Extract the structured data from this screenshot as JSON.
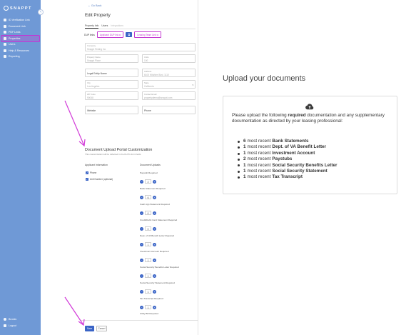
{
  "sidebar": {
    "logo": "SNAPPT",
    "items": [
      {
        "label": "ID Verification Link"
      },
      {
        "label": "Document Link"
      },
      {
        "label": "PDF Links"
      },
      {
        "label": "Properties"
      },
      {
        "label": "Users"
      },
      {
        "label": "Help & Resources"
      },
      {
        "label": "Reporting"
      }
    ],
    "bottom": [
      {
        "label": "Brooks"
      },
      {
        "label": "Logout"
      }
    ]
  },
  "form": {
    "back_label": "← Go Back",
    "title": "Edit Property",
    "tabs": [
      {
        "label": "Property Info"
      },
      {
        "label": "Users"
      },
      {
        "label": "Integrations"
      }
    ],
    "links_label": "DUP links",
    "applicant_link": "Applicant DUP link",
    "leasing_link": "Leasing Team Link",
    "company": {
      "label": "Company",
      "value": "Snappt Testing Inc"
    },
    "property_name": {
      "label": "Property Name",
      "value": "Snappt Place"
    },
    "units": {
      "label": "Units",
      "value": "100"
    },
    "legal_entity": {
      "label": "Legal Entity Name"
    },
    "address": {
      "label": "Address",
      "value": "6100 Wilshire Blvd, 1110"
    },
    "city": {
      "label": "City",
      "value": "Los Angeles"
    },
    "state": {
      "label": "State",
      "value": "California"
    },
    "zip": {
      "label": "ZIP Code",
      "value": "90048"
    },
    "contact_email": {
      "label": "Contact Email",
      "value": "propertydemo@snappt.com"
    },
    "website": {
      "label": "Website"
    },
    "phone": {
      "label": "Phone"
    },
    "portal_title": "Document Upload Portal Customization",
    "portal_subtitle": "This customization will be reflected in the DUP's form fields",
    "applicant_info_head": "Applicant Information",
    "applicant_checks": [
      {
        "label": "Phone"
      },
      {
        "label": "Unit Number (optional)"
      }
    ],
    "doc_uploads_head": "Document Uploads",
    "documents": [
      {
        "label": "Paystub Required",
        "count": "2"
      },
      {
        "label": "Bank Statement Required",
        "count": "6"
      },
      {
        "label": "Cash App Statement Required",
        "count": "0"
      },
      {
        "label": "Credit/Debit Card Statement Required",
        "count": "0"
      },
      {
        "label": "Dept. of VA Benefit Letter Required",
        "count": "1"
      },
      {
        "label": "Investment Account Required",
        "count": "1"
      },
      {
        "label": "Social Security Benefits Letter Required",
        "count": "1"
      },
      {
        "label": "Social Security Statement Required",
        "count": "1"
      },
      {
        "label": "Tax Transcript Required",
        "count": "1"
      },
      {
        "label": "Utility Bill Required",
        "count": "0"
      }
    ],
    "save_label": "Save",
    "cancel_label": "Cancel"
  },
  "preview": {
    "title": "Upload your documents",
    "intro_a": "Please upload the following ",
    "intro_b": "required",
    "intro_c": " documentation and any supplementary documentation as directed by your leasing professional:",
    "requirements": [
      {
        "count": "6",
        "text": "most recent",
        "doc": "Bank Statements"
      },
      {
        "count": "1",
        "text": "most recent",
        "doc": "Dept. of VA Benefit Letter"
      },
      {
        "count": "1",
        "text": "most recent",
        "doc": "Investment Account"
      },
      {
        "count": "2",
        "text": "most recent",
        "doc": "Paystubs"
      },
      {
        "count": "1",
        "text": "most recent",
        "doc": "Social Security Benefits Letter"
      },
      {
        "count": "1",
        "text": "most recent",
        "doc": "Social Security Statement"
      },
      {
        "count": "1",
        "text": "most recent",
        "doc": "Tax Transcript"
      }
    ]
  },
  "colors": {
    "sidebar": "#6f99d6",
    "accent": "#3a64c6",
    "highlight": "#c235d4"
  }
}
